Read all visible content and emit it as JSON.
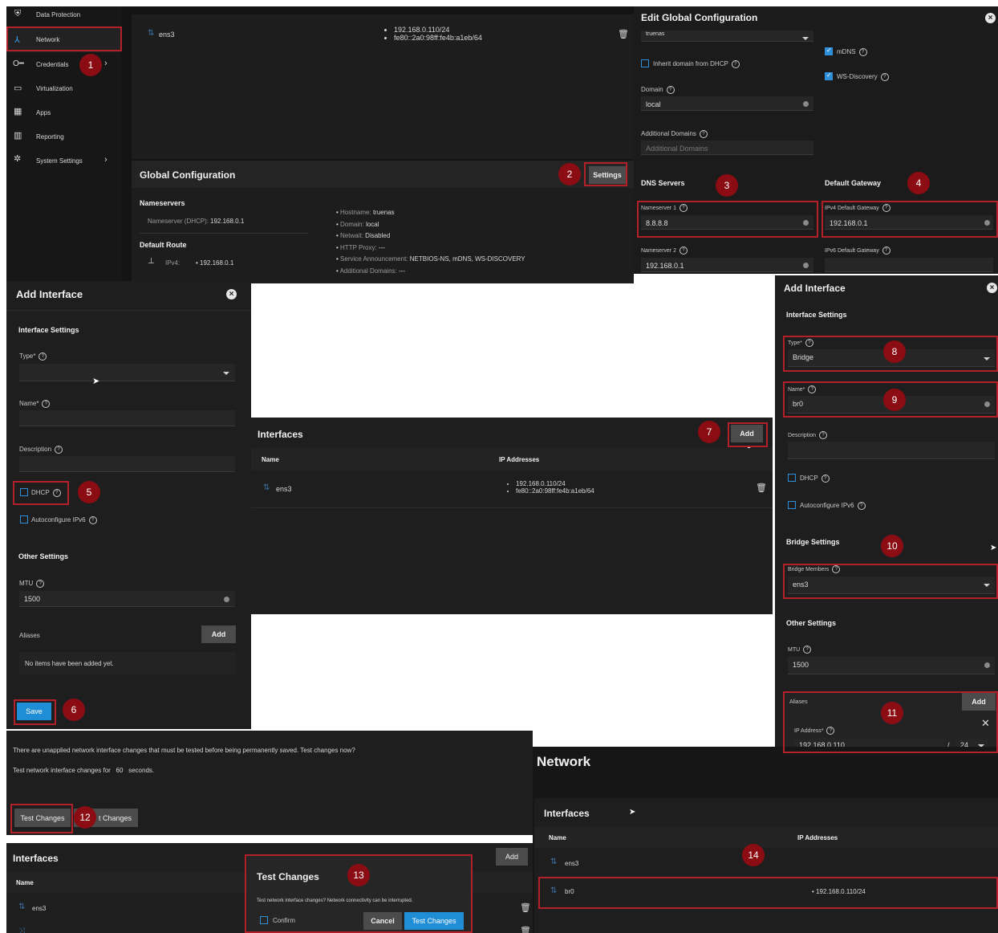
{
  "sidebar": {
    "items": [
      {
        "icon": "shield-icon",
        "label": "Data Protection"
      },
      {
        "icon": "network-icon",
        "label": "Network"
      },
      {
        "icon": "key-icon",
        "label": "Credentials"
      },
      {
        "icon": "monitor-icon",
        "label": "Virtualization"
      },
      {
        "icon": "grid-icon",
        "label": "Apps"
      },
      {
        "icon": "chart-icon",
        "label": "Reporting"
      },
      {
        "icon": "gear-icon",
        "label": "System Settings"
      }
    ]
  },
  "top_interface": {
    "name": "ens3",
    "ips": [
      "192.168.0.110/24",
      "fe80::2a0:98ff:fe4b:a1eb/64"
    ]
  },
  "global_config": {
    "title": "Global Configuration",
    "settings_button": "Settings",
    "nameservers_heading": "Nameservers",
    "nameserver_label": "Nameserver (DHCP):",
    "nameserver_value": "192.168.0.1",
    "default_route_heading": "Default Route",
    "route_label": "IPv4:",
    "route_value": "192.168.0.1",
    "details": [
      {
        "k": "Hostname:",
        "v": "truenas"
      },
      {
        "k": "Domain:",
        "v": "local"
      },
      {
        "k": "Netwait:",
        "v": "Disabled"
      },
      {
        "k": "HTTP Proxy:",
        "v": "---"
      },
      {
        "k": "Service Announcement:",
        "v": "NETBIOS-NS, mDNS, WS-DISCOVERY"
      },
      {
        "k": "Additional Domains:",
        "v": "---"
      }
    ]
  },
  "edit_global": {
    "title": "Edit Global Configuration",
    "hostname_value": "truenas",
    "inherit_label": "Inherit domain from DHCP",
    "domain_label": "Domain",
    "domain_value": "local",
    "additional_domains_label": "Additional Domains",
    "additional_domains_placeholder": "Additional Domains",
    "mdns_label": "mDNS",
    "wsd_label": "WS-Discovery",
    "dns_heading": "DNS Servers",
    "ns1_label": "Nameserver 1",
    "ns1_value": "8.8.8.8",
    "ns2_label": "Nameserver 2",
    "ns2_value": "192.168.0.1",
    "gateway_heading": "Default Gateway",
    "ipv4gw_label": "IPv4 Default Gateway",
    "ipv4gw_value": "192.168.0.1",
    "ipv6gw_label": "IPv6 Default Gateway"
  },
  "add_iface_left": {
    "title": "Add Interface",
    "settings_heading": "Interface Settings",
    "type_label": "Type*",
    "name_label": "Name*",
    "desc_label": "Description",
    "dhcp_label": "DHCP",
    "ipv6_label": "Autoconfigure IPv6",
    "other_heading": "Other Settings",
    "mtu_label": "MTU",
    "mtu_value": "1500",
    "aliases_label": "Aliases",
    "add_button": "Add",
    "empty_text": "No items have been added yet.",
    "save_button": "Save"
  },
  "interfaces_mid": {
    "title": "Interfaces",
    "add_button": "Add",
    "col_name": "Name",
    "col_ip": "IP Addresses",
    "row": {
      "name": "ens3",
      "ips": [
        "192.168.0.110/24",
        "fe80::2a0:98ff:fe4b:a1eb/64"
      ]
    }
  },
  "add_iface_right": {
    "title": "Add Interface",
    "settings_heading": "Interface Settings",
    "type_label": "Type*",
    "type_value": "Bridge",
    "name_label": "Name*",
    "name_value": "br0",
    "desc_label": "Description",
    "dhcp_label": "DHCP",
    "ipv6_label": "Autoconfigure IPv6",
    "bridge_heading": "Bridge Settings",
    "members_label": "Bridge Members",
    "members_value": "ens3",
    "other_heading": "Other Settings",
    "mtu_label": "MTU",
    "mtu_value": "1500",
    "aliases_label": "Aliases",
    "add_button": "Add",
    "ip_label": "IP Address*",
    "ip_value": "192.168.0.110",
    "mask_value": "24"
  },
  "test_banner": {
    "message": "There are unapplied network interface changes that must be tested before being permanently saved. Test changes now?",
    "seconds_label": "Test network interface changes for",
    "seconds_value": "60",
    "seconds_unit": "seconds.",
    "test_button": "Test Changes",
    "revert_partial": "t Changes"
  },
  "interfaces_bottom": {
    "title": "Interfaces",
    "add_button": "Add",
    "col_name": "Name",
    "row1": "ens3"
  },
  "test_dialog": {
    "title": "Test Changes",
    "message": "Test network interface changes? Network connectivity can be interrupted.",
    "confirm_label": "Confirm",
    "cancel_button": "Cancel",
    "test_button": "Test Changes"
  },
  "network_final": {
    "title": "Network",
    "interfaces_heading": "Interfaces",
    "col_name": "Name",
    "col_ip": "IP Addresses",
    "row1": "ens3",
    "row2": "br0",
    "row2_ip": "192.168.0.110/24"
  },
  "steps": [
    "1",
    "2",
    "3",
    "4",
    "5",
    "6",
    "7",
    "8",
    "9",
    "10",
    "11",
    "12",
    "13",
    "14"
  ],
  "colors": {
    "annotation_red": "#b3202a",
    "badge": "#8b0c12",
    "accent_blue": "#1f8ed6",
    "panel": "#1b1b1b"
  }
}
